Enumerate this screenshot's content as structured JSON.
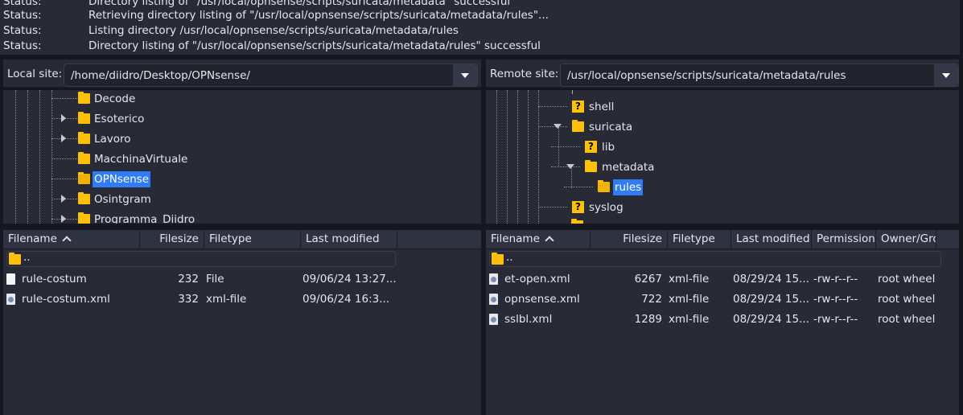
{
  "log": [
    {
      "label": "Status:",
      "message": "Directory listing of \"/usr/local/opnsense/scripts/suricata/metadata\" successful"
    },
    {
      "label": "Status:",
      "message": "Retrieving directory listing of \"/usr/local/opnsense/scripts/suricata/metadata/rules\"..."
    },
    {
      "label": "Status:",
      "message": "Listing directory /usr/local/opnsense/scripts/suricata/metadata/rules"
    },
    {
      "label": "Status:",
      "message": "Directory listing of \"/usr/local/opnsense/scripts/suricata/metadata/rules\" successful"
    }
  ],
  "local": {
    "site_label": "Local site:",
    "path": "/home/diidro/Desktop/OPNsense/",
    "tree": [
      {
        "name": "Decode",
        "expander": "none",
        "selected": false
      },
      {
        "name": "Esoterico",
        "expander": "collapsed",
        "selected": false
      },
      {
        "name": "Lavoro",
        "expander": "collapsed",
        "selected": false
      },
      {
        "name": "MacchinaVirtuale",
        "expander": "none",
        "selected": false
      },
      {
        "name": "OPNsense",
        "expander": "none",
        "selected": true
      },
      {
        "name": "Osintgram",
        "expander": "collapsed",
        "selected": false
      },
      {
        "name": "Programma_Diidro",
        "expander": "collapsed",
        "selected": false
      }
    ],
    "columns": {
      "filename": "Filename",
      "filesize": "Filesize",
      "filetype": "Filetype",
      "last_modified": "Last modified"
    },
    "updir": "..",
    "files": [
      {
        "name": "rule-costum",
        "size": "232",
        "type": "File",
        "modified": "09/06/24 13:27...",
        "icon": "file-icon"
      },
      {
        "name": "rule-costum.xml",
        "size": "332",
        "type": "xml-file",
        "modified": "09/06/24 16:3...",
        "icon": "xml-file-icon"
      }
    ]
  },
  "remote": {
    "site_label": "Remote site:",
    "path": "/usr/local/opnsense/scripts/suricata/metadata/rules",
    "tree": [
      {
        "name": "shell",
        "icon": "unknown-folder-icon",
        "level": 0,
        "expander": "none",
        "selected": false
      },
      {
        "name": "suricata",
        "icon": "folder-icon",
        "level": 0,
        "expander": "expanded",
        "selected": false
      },
      {
        "name": "lib",
        "icon": "unknown-folder-icon",
        "level": 1,
        "expander": "none",
        "selected": false
      },
      {
        "name": "metadata",
        "icon": "folder-icon",
        "level": 1,
        "expander": "expanded",
        "selected": false
      },
      {
        "name": "rules",
        "icon": "open-folder-icon",
        "level": 2,
        "expander": "none",
        "selected": true
      },
      {
        "name": "syslog",
        "icon": "unknown-folder-icon",
        "level": 0,
        "expander": "none",
        "selected": false
      }
    ],
    "columns": {
      "filename": "Filename",
      "filesize": "Filesize",
      "filetype": "Filetype",
      "last_modified": "Last modified",
      "permissions": "Permission",
      "owner": "Owner/Grou"
    },
    "updir": "..",
    "files": [
      {
        "name": "et-open.xml",
        "size": "6267",
        "type": "xml-file",
        "modified": "08/29/24 15...",
        "permissions": "-rw-r--r--",
        "owner": "root wheel"
      },
      {
        "name": "opnsense.xml",
        "size": "722",
        "type": "xml-file",
        "modified": "08/29/24 15...",
        "permissions": "-rw-r--r--",
        "owner": "root wheel"
      },
      {
        "name": "sslbl.xml",
        "size": "1289",
        "type": "xml-file",
        "modified": "08/29/24 15...",
        "permissions": "-rw-r--r--",
        "owner": "root wheel"
      }
    ]
  },
  "colors": {
    "background": "#282a36",
    "selection": "#2f7cf6",
    "folder": "#ffc107"
  }
}
